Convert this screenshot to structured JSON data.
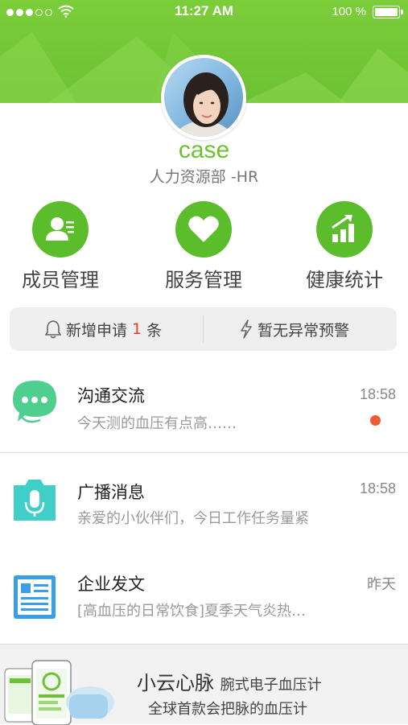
{
  "status_bar": {
    "time": "11:27 AM",
    "battery": "100 %",
    "signal_icon": "signal-dots-icon",
    "wifi_icon": "wifi-icon"
  },
  "profile": {
    "name": "case",
    "department": "人力资源部 -HR"
  },
  "actions": [
    {
      "label": "成员管理",
      "icon": "member-icon"
    },
    {
      "label": "服务管理",
      "icon": "heart-icon"
    },
    {
      "label": "健康统计",
      "icon": "chart-icon"
    }
  ],
  "notices": {
    "left_prefix": "新增申请",
    "left_count": "1",
    "left_suffix": "条",
    "right": "暂无异常预警"
  },
  "messages": [
    {
      "title": "沟通交流",
      "time": "18:58",
      "preview": "今天测的血压有点高……",
      "icon": "chat-icon",
      "unread": true
    },
    {
      "title": "广播消息",
      "time": "18:58",
      "preview": "亲爱的小伙伴们，今日工作任务量紧",
      "icon": "microphone-icon",
      "unread": false
    },
    {
      "title": "企业发文",
      "time": "昨天",
      "preview": "[高血压的日常饮食]夏季天气炎热…",
      "icon": "document-icon",
      "unread": false
    }
  ],
  "banner": {
    "brand": "小云心脉",
    "product": "腕式电子血压计",
    "subtitle": "全球首款会把脉的血压计"
  },
  "colors": {
    "accent": "#5bbd2b",
    "header": "#6cc234",
    "unread_dot": "#ef5b34",
    "chat_icon": "#4fcf8f",
    "mic_icon": "#3fcfc8",
    "doc_icon": "#3a9ee6"
  }
}
